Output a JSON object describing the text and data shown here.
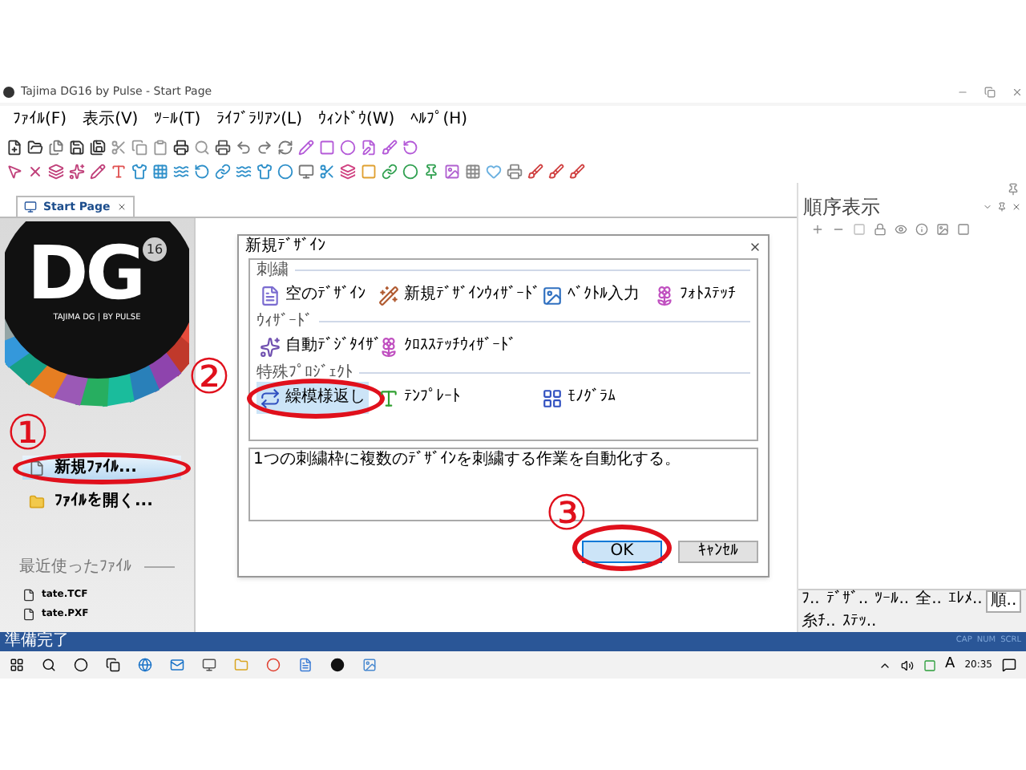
{
  "window": {
    "title": "Tajima DG16 by Pulse - Start Page"
  },
  "menu": [
    "ﾌｧｲﾙ(F)",
    "表示(V)",
    "ﾂｰﾙ(T)",
    "ﾗｲﾌﾞﾗﾘｱﾝ(L)",
    "ｳｨﾝﾄﾞｳ(W)",
    "ﾍﾙﾌﾟ(H)"
  ],
  "document_tabs": [
    {
      "label": "Start Page",
      "selected": true
    }
  ],
  "start_page": {
    "logo_text": "DG",
    "logo_badge": "16",
    "logo_caption": "TAJIMA DG | BY PULSE",
    "actions": [
      {
        "label": "新規ﾌｧｲﾙ...",
        "selected": true,
        "circled": true
      },
      {
        "label": "ﾌｧｲﾙを開く...",
        "selected": false,
        "circled": false
      }
    ],
    "recent_heading": "最近使ったﾌｧｲﾙ",
    "recent_files": [
      "tate.TCF",
      "tate.PXF"
    ]
  },
  "dialog": {
    "title": "新規ﾃﾞｻﾞｲﾝ",
    "sections": [
      {
        "heading": "刺繍",
        "items": [
          {
            "label": "空のﾃﾞｻﾞｲﾝ",
            "selected": false,
            "circled": false
          },
          {
            "label": "新規ﾃﾞｻﾞｲﾝｳｨｻﾞｰﾄﾞ",
            "selected": false,
            "circled": false
          },
          {
            "label": "ﾍﾞｸﾄﾙ入力",
            "selected": false,
            "circled": false
          },
          {
            "label": "ﾌｫﾄｽﾃｯﾁ",
            "selected": false,
            "circled": false
          }
        ]
      },
      {
        "heading": "ｳｨｻﾞｰﾄﾞ",
        "items": [
          {
            "label": "自動ﾃﾞｼﾞﾀｲｻﾞ",
            "selected": false,
            "circled": false
          },
          {
            "label": "ｸﾛｽｽﾃｯﾁｳｨｻﾞｰﾄﾞ",
            "selected": false,
            "circled": false
          }
        ]
      },
      {
        "heading": "特殊ﾌﾟﾛｼﾞｪｸﾄ",
        "items": [
          {
            "label": "繰模様返し",
            "selected": true,
            "circled": true
          },
          {
            "label": "ﾃﾝﾌﾟﾚｰﾄ",
            "selected": false,
            "circled": false
          },
          {
            "label": "ﾓﾉｸﾞﾗﾑ",
            "selected": false,
            "circled": false
          }
        ]
      }
    ],
    "description": "1つの刺繍枠に複数のﾃﾞｻﾞｲﾝを刺繍する作業を自動化する。",
    "buttons": [
      {
        "label": "OK",
        "selected": true,
        "circled": true
      },
      {
        "label": "ｷｬﾝｾﾙ",
        "selected": false,
        "circled": false
      }
    ]
  },
  "annotations": [
    "①",
    "②",
    "③"
  ],
  "side_panel": {
    "title": "順序表示",
    "tabs": [
      {
        "label": "ﾌ..",
        "selected": false
      },
      {
        "label": "ﾃﾞｻﾞ..",
        "selected": false
      },
      {
        "label": "ﾂｰﾙ..",
        "selected": false
      },
      {
        "label": "全..",
        "selected": false
      },
      {
        "label": "ｴﾚﾒ..",
        "selected": false
      },
      {
        "label": "順..",
        "selected": true
      },
      {
        "label": "糸ﾁ..",
        "selected": false
      },
      {
        "label": "ｽﾃｯ..",
        "selected": false
      }
    ]
  },
  "status_bar": {
    "message": "準備完了",
    "indicators": [
      "CAP",
      "NUM",
      "SCRL"
    ]
  },
  "taskbar": {
    "ime": "A",
    "time": "20:35"
  }
}
